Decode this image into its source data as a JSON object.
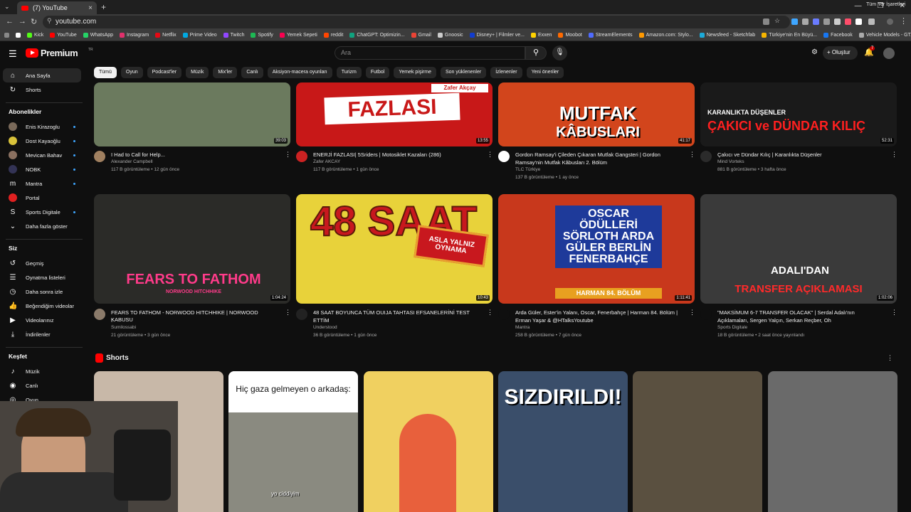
{
  "browser": {
    "tab_title": "(7) YouTube",
    "url": "youtube.com",
    "bookmarks": [
      {
        "label": "Kick",
        "color": "#53fc18"
      },
      {
        "label": "YouTube",
        "color": "#ff0000"
      },
      {
        "label": "WhatsApp",
        "color": "#25d366"
      },
      {
        "label": "Instagram",
        "color": "#e1306c"
      },
      {
        "label": "Netflix",
        "color": "#e50914"
      },
      {
        "label": "Prime Video",
        "color": "#00a8e1"
      },
      {
        "label": "Twitch",
        "color": "#9146ff"
      },
      {
        "label": "Spotify",
        "color": "#1db954"
      },
      {
        "label": "Yemek Sepeti",
        "color": "#fa0050"
      },
      {
        "label": "reddit",
        "color": "#ff4500"
      },
      {
        "label": "ChatGPT: Optimizin...",
        "color": "#10a37f"
      },
      {
        "label": "Gmail",
        "color": "#ea4335"
      },
      {
        "label": "Gnoosic",
        "color": "#cccccc"
      },
      {
        "label": "Disney+ | Filmler ve...",
        "color": "#113ccf"
      },
      {
        "label": "Exxen",
        "color": "#ffd200"
      },
      {
        "label": "Moobot",
        "color": "#ff6a00"
      },
      {
        "label": "StreamElements",
        "color": "#4f6bff"
      },
      {
        "label": "Amazon.com: Stylo...",
        "color": "#ff9900"
      },
      {
        "label": "Newsfeed - Sketchfab",
        "color": "#1caad9"
      },
      {
        "label": "Türkiye'nin En Büyü...",
        "color": "#f7b500"
      },
      {
        "label": "Facebook",
        "color": "#1877f2"
      },
      {
        "label": "Vehicle Models - GT...",
        "color": "#aaaaaa"
      }
    ],
    "all_bookmarks": "Tüm Yer İşaretleri"
  },
  "header": {
    "logo": "Premium",
    "logo_sup": "TR",
    "search_placeholder": "Ara",
    "create_label": "Oluştur",
    "notif_count": "7"
  },
  "sidebar": {
    "main": [
      {
        "label": "Ana Sayfa",
        "icon": "home-icon",
        "glyph": "⌂"
      },
      {
        "label": "Shorts",
        "icon": "shorts-icon",
        "glyph": "↻"
      }
    ],
    "subs_head": "Abonelikler",
    "subs": [
      {
        "label": "Enis Kirazoglu",
        "color": "#7a6a5a"
      },
      {
        "label": "Dost Kayaoğlu",
        "color": "#d8c23a"
      },
      {
        "label": "Mevican Bahav",
        "color": "#8a7060"
      },
      {
        "label": "NOBK",
        "color": "#333355"
      },
      {
        "label": "Mantra",
        "glyph": "m",
        "color": "#0f0f0f"
      },
      {
        "label": "Portal",
        "color": "#e02020"
      },
      {
        "label": "Sports Digitale",
        "glyph": "S",
        "color": "#0f0f0f"
      },
      {
        "label": "Daha fazla göster",
        "glyph": "⌄"
      }
    ],
    "you_head": "Siz",
    "you": [
      {
        "label": "Geçmiş",
        "icon": "history-icon",
        "glyph": "↺"
      },
      {
        "label": "Oynatma listeleri",
        "icon": "playlist-icon",
        "glyph": "☰"
      },
      {
        "label": "Daha sonra izle",
        "icon": "clock-icon",
        "glyph": "◷"
      },
      {
        "label": "Beğendiğim videolar",
        "icon": "like-icon",
        "glyph": "👍"
      },
      {
        "label": "Videolarınız",
        "icon": "video-icon",
        "glyph": "▶"
      },
      {
        "label": "İndirilenler",
        "icon": "download-icon",
        "glyph": "⤓"
      }
    ],
    "explore_head": "Keşfet",
    "explore": [
      {
        "label": "Müzik",
        "icon": "music-icon",
        "glyph": "♪"
      },
      {
        "label": "Canlı",
        "icon": "live-icon",
        "glyph": "◉"
      },
      {
        "label": "Oyun",
        "icon": "game-icon",
        "glyph": "◎"
      }
    ]
  },
  "chips": [
    "Tümü",
    "Oyun",
    "Podcast'ler",
    "Müzik",
    "Mix'ler",
    "Canlı",
    "Aksiyon-macera oyunları",
    "Turizm",
    "Futbol",
    "Yemek pişirme",
    "Son yüklenenler",
    "İzlenenler",
    "Yeni öneriler"
  ],
  "videos": [
    {
      "title": "I Had to Call for Help...",
      "title2": "",
      "channel": "Alexander Campbell",
      "meta": "117 B görüntüleme • 12 gün önce",
      "duration": "39:03",
      "thumb_bg": "#6b7a5e",
      "av_color": "#a08060",
      "thumb_text": "",
      "thumb_text2": ""
    },
    {
      "title": "ENERJİ FAZLASI| 5Sriders | Motosiklet Kazaları (286)",
      "title2": "",
      "channel": "Zafer AKCAY",
      "meta": "117 B görüntüleme • 1 gün önce",
      "duration": "13:55",
      "thumb_bg": "#c81818",
      "av_color": "#cc2222",
      "thumb_text": "FAZLASI",
      "thumb_text2": "Zafer Akçay"
    },
    {
      "title": "Gordon Ramsay'i Çileden Çıkaran Mutfak Gangsteri | Gordon",
      "title2": "Ramsay'nin Mutfak Kâbusları 2. Bölüm",
      "channel": "TLC Türkiye",
      "meta": "137 B görüntüleme • 1 ay önce",
      "duration": "41:17",
      "thumb_bg": "#d2451c",
      "av_color": "#ffffff",
      "thumb_text": "MUTFAK",
      "thumb_text2": "KÂBUSLARI"
    },
    {
      "title": "Çakıcı ve Dündar Kılıç | Karanlıkta Düşenler",
      "title2": "",
      "channel": "Mind Vorteks",
      "meta": "881 B görüntüleme • 3 hafta önce",
      "duration": "52:31",
      "thumb_bg": "#1a1a1a",
      "av_color": "#2b2b2b",
      "thumb_text": "KARANLIKTA DÜŞENLER",
      "thumb_text2": "ÇAKICI ve DÜNDAR KILIÇ"
    },
    {
      "title": "FEARS TO FATHOM - NORWOOD HITCHHIKE | NORWOOD KABUSU",
      "title2": "!",
      "channel": "Sumilossabi",
      "meta": "21 görüntüleme • 3 gün önce",
      "duration": "1:04:24",
      "thumb_bg": "#2b2b28",
      "av_color": "#8a7a6a",
      "thumb_text": "FEARS TO FATHOM",
      "thumb_text2": "NORWOOD HITCHHIKE"
    },
    {
      "title": "48 SAAT BOYUNCA TÜM OUIJA TAHTASI EFSANELERİNİ TEST",
      "title2": "ETTİM",
      "channel": "Understood",
      "meta": "36 B görüntüleme • 1 gün önce",
      "duration": "10:43",
      "thumb_bg": "#e8d23a",
      "av_color": "#222222",
      "thumb_text": "48 SAAT",
      "thumb_text2": "ASLA YALNIZ OYNAMA"
    },
    {
      "title": "Arda Güler, Ester'in Yalanı, Oscar, Fenerbahçe | Harman 84. Bölüm |",
      "title2": "Erman Yaşar & @HTalksYoutube",
      "channel": "Mantra",
      "meta": "258 B görüntüleme • 7 gün önce",
      "duration": "1:11:41",
      "thumb_bg": "#c8381c",
      "av_color": "#0f0f0f",
      "thumb_text": "OSCAR ÖDÜLLERİ SÖRLOTH ARDA GÜLER BERLİN FENERBAHÇE",
      "thumb_text2": "HARMAN 84. BÖLÜM"
    },
    {
      "title": "\"MAKSİMUM 6-7 TRANSFER OLACAK\" | Serdal Adalı'nın",
      "title2": "Açıklamaları, Sergen Yalçın, Serkan Reçber, Oh",
      "channel": "Sports Digitale",
      "meta": "18 B görüntüleme • 2 saat önce yayınlandı",
      "duration": "1:02:06",
      "thumb_bg": "#3a3a3a",
      "av_color": "#0f0f0f",
      "thumb_text": "ADALI'DAN",
      "thumb_text2": "TRANSFER AÇIKLAMASI"
    }
  ],
  "shorts": {
    "title": "Shorts",
    "items": [
      {
        "bg": "#c8b8a8",
        "caption": ""
      },
      {
        "bg": "#8a8a80",
        "caption": "Hiç gaza gelmeyen o arkadaş:",
        "sub": "yo ciddiyim"
      },
      {
        "bg": "#f0d060",
        "caption": ""
      },
      {
        "bg": "#3a4e6a",
        "caption": "SIZDIRILDI!"
      },
      {
        "bg": "#5a5040",
        "caption": ""
      },
      {
        "bg": "#6a6a6a",
        "caption": ""
      }
    ]
  }
}
